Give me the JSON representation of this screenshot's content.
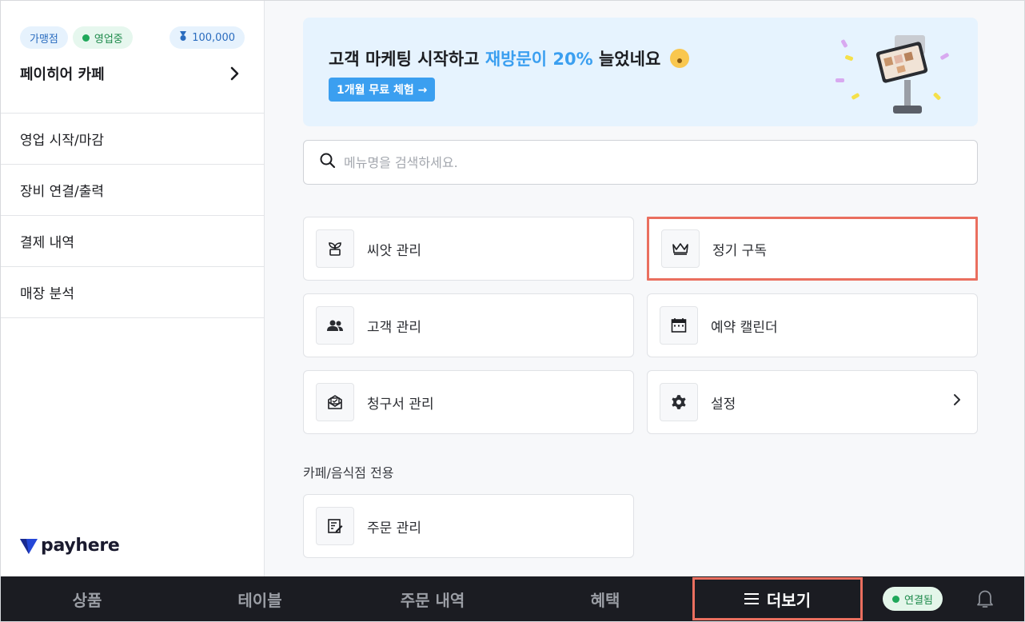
{
  "sidebar": {
    "chips": {
      "franchise": "가맹점",
      "status": "영업중",
      "points": "100,000"
    },
    "store_name": "페이히어 카페",
    "items": [
      {
        "label": "영업 시작/마감"
      },
      {
        "label": "장비 연결/출력"
      },
      {
        "label": "결제 내역"
      },
      {
        "label": "매장 분석"
      }
    ],
    "logo_text": "payhere"
  },
  "banner": {
    "title_pre": "고객 마케팅 시작하고 ",
    "title_highlight": "재방문이 20%",
    "title_post": " 늘었네요",
    "button_label": "1개월 무료 체험 →"
  },
  "search": {
    "placeholder": "메뉴명을 검색하세요."
  },
  "menu": {
    "cards": [
      {
        "label": "씨앗 관리",
        "icon": "sprout-icon"
      },
      {
        "label": "정기 구독",
        "icon": "crown-icon"
      },
      {
        "label": "고객 관리",
        "icon": "people-icon"
      },
      {
        "label": "예약 캘린더",
        "icon": "calendar-icon"
      },
      {
        "label": "청구서 관리",
        "icon": "invoice-icon"
      },
      {
        "label": "설정",
        "icon": "gear-icon"
      }
    ],
    "section_title": "카페/음식점 전용",
    "section_cards": [
      {
        "label": "주문 관리",
        "icon": "order-edit-icon"
      }
    ]
  },
  "bottom_nav": {
    "tabs": [
      {
        "label": "상품"
      },
      {
        "label": "테이블"
      },
      {
        "label": "주문 내역"
      },
      {
        "label": "혜택"
      },
      {
        "label": "더보기"
      }
    ],
    "connection": "연결됨"
  },
  "colors": {
    "accent": "#3b9ff0",
    "highlight_border": "#ea6f5f",
    "bottom_bar": "#1b1c22",
    "status_green": "#1fa85a"
  }
}
